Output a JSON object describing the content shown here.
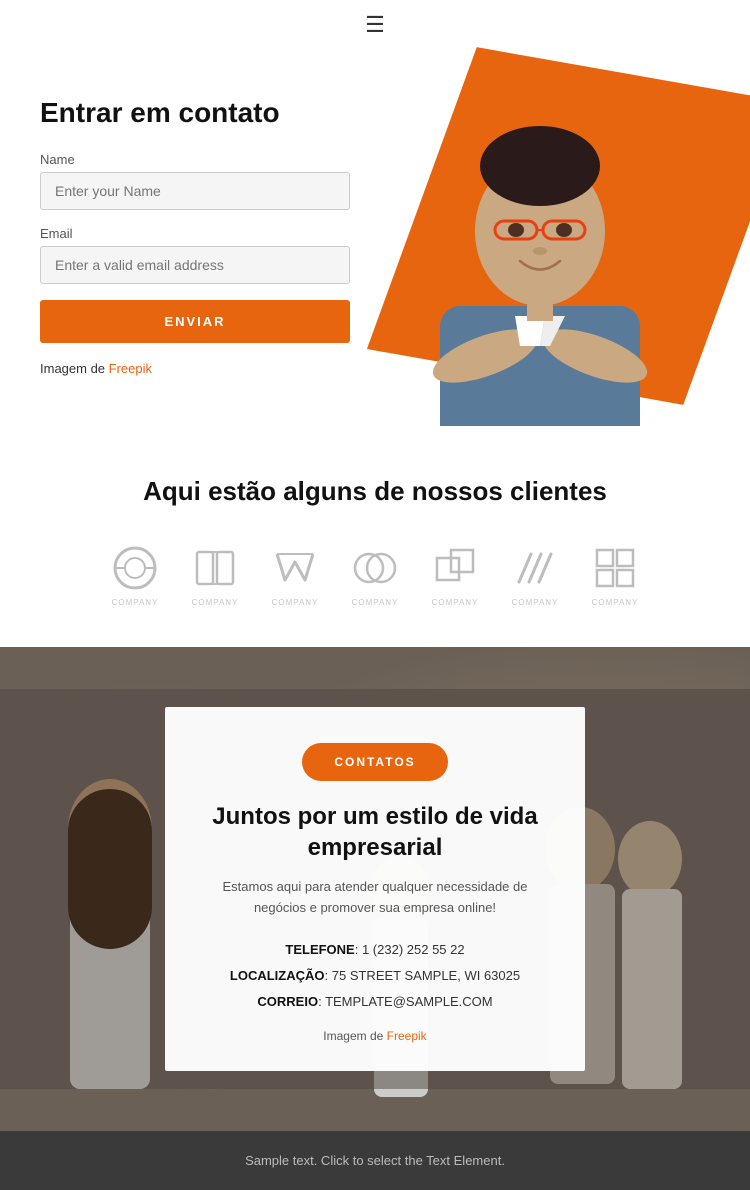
{
  "header": {
    "hamburger_aria": "Menu"
  },
  "hero": {
    "title": "Entrar em contato",
    "name_label": "Name",
    "name_placeholder": "Enter your Name",
    "email_label": "Email",
    "email_placeholder": "Enter a valid email address",
    "button_label": "ENVIAR",
    "image_credit_prefix": "Imagem de ",
    "image_credit_link": "Freepik"
  },
  "clients": {
    "title": "Aqui estão alguns de nossos clientes",
    "logos": [
      {
        "label": "COMPANY"
      },
      {
        "label": "COMPANY"
      },
      {
        "label": "COMPANY"
      },
      {
        "label": "COMPANY"
      },
      {
        "label": "COMPANY"
      },
      {
        "label": "COMPANY"
      },
      {
        "label": "COMPANY"
      }
    ]
  },
  "contact_banner": {
    "button_label": "CONTATOS",
    "heading": "Juntos por um estilo de vida empresarial",
    "description": "Estamos aqui para atender qualquer necessidade de negócios e promover sua empresa online!",
    "phone_label": "TELEFONE",
    "phone_value": "1 (232) 252 55 22",
    "location_label": "LOCALIZAÇÃO",
    "location_value": "75 STREET SAMPLE, WI 63025",
    "email_label": "CORREIO",
    "email_value": "TEMPLATE@SAMPLE.COM",
    "image_credit_prefix": "Imagem de ",
    "image_credit_link": "Freepik"
  },
  "footer": {
    "text": "Sample text. Click to select the Text Element."
  }
}
